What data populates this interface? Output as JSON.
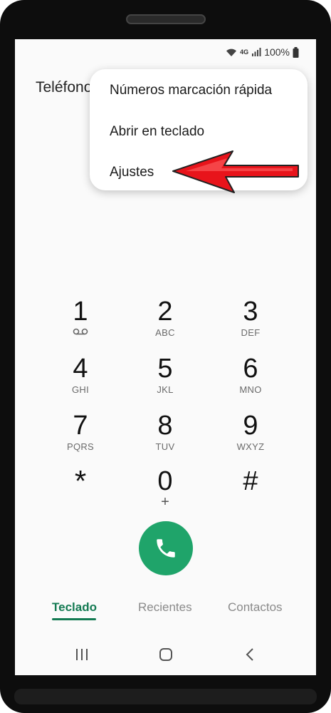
{
  "status_bar": {
    "wifi_icon": "wifi-icon",
    "network_label": "4G",
    "signal_icon": "signal-icon",
    "battery_percent": "100%",
    "battery_icon": "battery-icon"
  },
  "app": {
    "title": "Teléfono"
  },
  "menu": {
    "items": [
      {
        "label": "Números marcación rápida"
      },
      {
        "label": "Abrir en teclado"
      },
      {
        "label": "Ajustes"
      }
    ],
    "arrow_color": "#e8141b"
  },
  "keypad": {
    "keys": [
      {
        "digit": "1",
        "letters": "",
        "icon": "voicemail-icon"
      },
      {
        "digit": "2",
        "letters": "ABC"
      },
      {
        "digit": "3",
        "letters": "DEF"
      },
      {
        "digit": "4",
        "letters": "GHI"
      },
      {
        "digit": "5",
        "letters": "JKL"
      },
      {
        "digit": "6",
        "letters": "MNO"
      },
      {
        "digit": "7",
        "letters": "PQRS"
      },
      {
        "digit": "8",
        "letters": "TUV"
      },
      {
        "digit": "9",
        "letters": "WXYZ"
      },
      {
        "digit": "*",
        "letters": ""
      },
      {
        "digit": "0",
        "letters": "+"
      },
      {
        "digit": "#",
        "letters": ""
      }
    ]
  },
  "call_button": {
    "icon": "phone-icon",
    "color": "#1fa46a"
  },
  "tabs": [
    {
      "label": "Teclado",
      "active": true
    },
    {
      "label": "Recientes",
      "active": false
    },
    {
      "label": "Contactos",
      "active": false
    }
  ],
  "accent_color": "#137a52",
  "nav_bar": {
    "recents_icon": "recents-icon",
    "home_icon": "home-icon",
    "back_icon": "back-icon"
  }
}
